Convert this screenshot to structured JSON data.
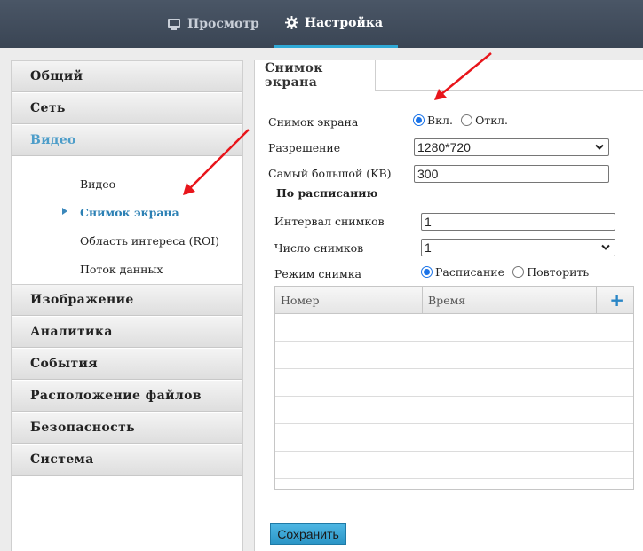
{
  "topnav": {
    "items": [
      {
        "label": "Просмотр",
        "icon": "monitor-icon"
      },
      {
        "label": "Настройка",
        "icon": "gear-icon"
      }
    ]
  },
  "sidebar": {
    "items": [
      {
        "label": "Общий"
      },
      {
        "label": "Сеть"
      },
      {
        "label": "Видео"
      },
      {
        "label": "Изображение"
      },
      {
        "label": "Аналитика"
      },
      {
        "label": "События"
      },
      {
        "label": "Расположение файлов"
      },
      {
        "label": "Безопасность"
      },
      {
        "label": "Система"
      }
    ],
    "submenu": [
      {
        "label": "Видео"
      },
      {
        "label": "Снимок экрана"
      },
      {
        "label": "Область интереса (ROI)"
      },
      {
        "label": "Поток данных"
      }
    ]
  },
  "main": {
    "tab": "Снимок экрана",
    "snapshot": {
      "label": "Снимок экрана",
      "on": "Вкл.",
      "off": "Откл.",
      "selected": "on"
    },
    "resolution": {
      "label": "Разрешение",
      "value": "1280*720"
    },
    "max_size": {
      "label": "Самый большой (KB)",
      "value": "300"
    },
    "schedule": {
      "legend": "По расписанию",
      "interval": {
        "label": "Интервал снимков",
        "value": "1"
      },
      "count": {
        "label": "Число снимков",
        "value": "1"
      },
      "mode": {
        "label": "Режим снимка",
        "opt1": "Расписание",
        "opt2": "Повторить",
        "selected": "opt1"
      }
    },
    "table": {
      "col1": "Номер",
      "col2": "Время",
      "add": "+"
    },
    "save": "Сохранить"
  },
  "colors": {
    "topbar": "#3f4a59",
    "accent": "#2fa9d6",
    "active_menu": "#4d9dc9",
    "arrow": "#e8151b"
  }
}
